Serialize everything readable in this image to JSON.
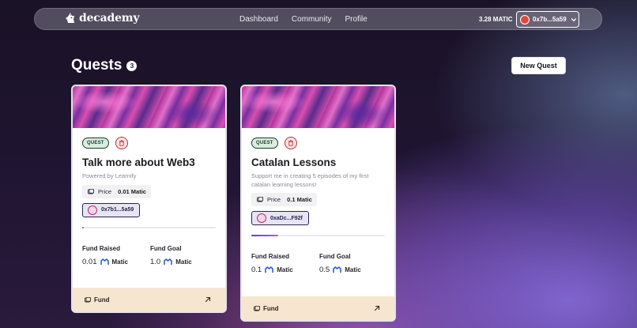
{
  "navbar": {
    "logo_text": "decademy",
    "links": [
      "Dashboard",
      "Community",
      "Profile"
    ],
    "balance": "3.28 MATIC",
    "wallet_address": "0x7b...5a59"
  },
  "page": {
    "title": "Quests",
    "count": "3",
    "new_quest_label": "New Quest"
  },
  "cards": [
    {
      "tag": "QUEST",
      "title": "Talk more about Web3",
      "description": "Powered by Learnify",
      "price_label": "Price",
      "price_value": "0.01 Matic",
      "creator": "0x7b1...5a59",
      "progress": 0.01,
      "fund_raised_label": "Fund Raised",
      "fund_raised": "0.01",
      "fund_goal_label": "Fund Goal",
      "fund_goal": "1.0",
      "currency": "Matic",
      "fund_label": "Fund"
    },
    {
      "tag": "QUEST",
      "title": "Catalan Lessons",
      "description": "Support me in creating 5 episodes of my first catalan learning lessons!",
      "price_label": "Price",
      "price_value": "0.1 Matic",
      "creator": "0xaDc...F92f",
      "progress": 0.2,
      "fund_raised_label": "Fund Raised",
      "fund_raised": "0.1",
      "fund_goal_label": "Fund Goal",
      "fund_goal": "0.5",
      "currency": "Matic",
      "fund_label": "Fund"
    }
  ],
  "colors": {
    "accent": "#6a3fc0",
    "fund_footer": "#f6e6cf",
    "quest_tag": "#d7eedf"
  }
}
